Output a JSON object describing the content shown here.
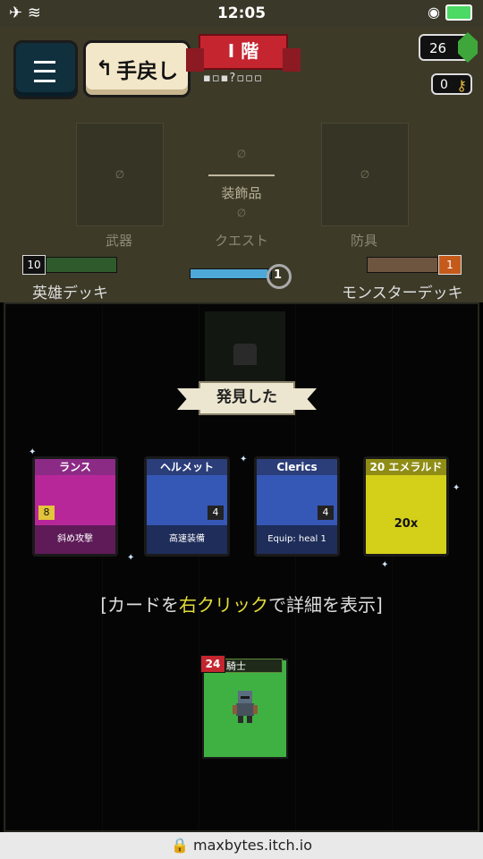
{
  "status_bar": {
    "time": "12:05",
    "left_icons": "✈ ≋",
    "right_icons": "◉"
  },
  "header": {
    "undo_label": "手戻し",
    "floor_label": "I 階",
    "floor_progress": "▪▫▪?▫▫▫",
    "emerald_count": "26",
    "key_count": "0"
  },
  "equipment": {
    "weapon_label": "武器",
    "quest_label": "クエスト",
    "accessory_label": "装飾品",
    "armor_label": "防具",
    "empty_mark": "∅"
  },
  "decks": {
    "hero_count": "10",
    "hero_label": "英雄デッキ",
    "monster_count": "1",
    "monster_label": "モンスターデッキ",
    "level": "1",
    "xp_fraction": 0.95
  },
  "board": {
    "found_banner": "発見した",
    "hint_prefix": "[カードを",
    "hint_highlight": "右クリック",
    "hint_suffix": "で詳細を表示]",
    "cards": [
      {
        "title": "ランス",
        "desc": "斜め攻撃",
        "badge": "8",
        "title_color": "#8c2b86",
        "art_color": "#b8279a",
        "desc_color": "#5e1b58"
      },
      {
        "title": "ヘルメット",
        "desc": "高速装備",
        "badge": "4",
        "title_color": "#2b3e7a",
        "art_color": "#3557b5",
        "desc_color": "#1e2d59"
      },
      {
        "title": "Clerics Shield",
        "desc": "Equip: heal 1",
        "badge": "4",
        "title_color": "#2b3e7a",
        "art_color": "#3557b5",
        "desc_color": "#1e2d59"
      },
      {
        "title": "20 エメラルド",
        "desc": "20x",
        "badge": "",
        "title_color": "#8f8d15",
        "art_color": "#d4cf19",
        "desc_color": "#d4cf19"
      }
    ],
    "hero_card": {
      "hp": "24",
      "name": "騎士"
    }
  },
  "browser": {
    "url": "maxbytes.itch.io"
  }
}
